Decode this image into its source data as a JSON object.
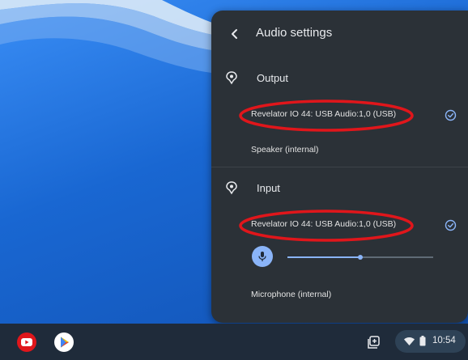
{
  "panel": {
    "title": "Audio settings",
    "output": {
      "label": "Output",
      "devices": [
        {
          "name": "Revelator IO 44: USB Audio:1,0 (USB)",
          "selected": true
        },
        {
          "name": "Speaker (internal)",
          "selected": false
        }
      ]
    },
    "input": {
      "label": "Input",
      "devices": [
        {
          "name": "Revelator IO 44: USB Audio:1,0 (USB)",
          "selected": true
        },
        {
          "name": "Microphone (internal)",
          "selected": false
        }
      ],
      "gain_fraction": 0.5
    }
  },
  "shelf": {
    "apps": [
      "youtube-icon",
      "play-store-icon"
    ],
    "clock": "10:54"
  },
  "colors": {
    "panel_bg": "#2b3137",
    "accent": "#8ab4f8",
    "highlight_ellipse": "#e0161b"
  }
}
